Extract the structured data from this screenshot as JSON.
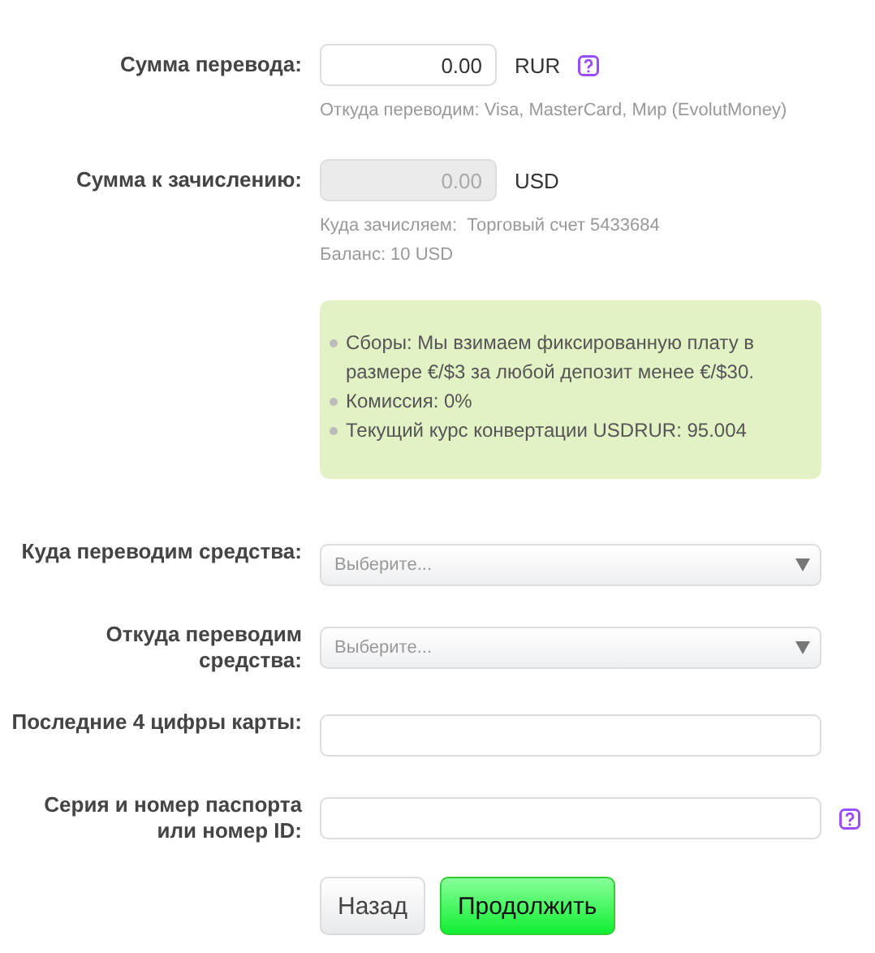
{
  "rows": [
    {
      "kind": "amount",
      "label": "Сумма перевода:",
      "value": "0.00",
      "disabled": false,
      "currency": "RUR",
      "help": true,
      "hints": [
        "Откуда переводим: Visa, MasterCard, Мир (EvolutMoney)"
      ]
    },
    {
      "kind": "amount",
      "label": "Сумма к зачислению:",
      "value": "0.00",
      "disabled": true,
      "currency": "USD",
      "help": false,
      "hints": [
        "Куда зачисляем:  Торговый счет 5433684",
        "Баланс: 10 USD"
      ]
    },
    {
      "kind": "info",
      "items": [
        "Сборы: Мы взимаем фиксированную плату в размере €/$3 за любой депозит менее €/$30.",
        "Комиссия: 0%",
        "Текущий курс конвертации USDRUR: 95.004"
      ]
    },
    {
      "kind": "select",
      "label": "Куда переводим средства:",
      "placeholder": "Выберите..."
    },
    {
      "kind": "select",
      "label": "Откуда переводим средства:",
      "placeholder": "Выберите..."
    },
    {
      "kind": "text",
      "label": "Последние 4 цифры карты:",
      "help": false
    },
    {
      "kind": "text",
      "label": "Серия и номер паспорта или номер ID:",
      "help": true
    }
  ],
  "buttons": [
    {
      "label": "Назад",
      "kind": "secondary"
    },
    {
      "label": "Продолжить",
      "kind": "primary"
    }
  ]
}
